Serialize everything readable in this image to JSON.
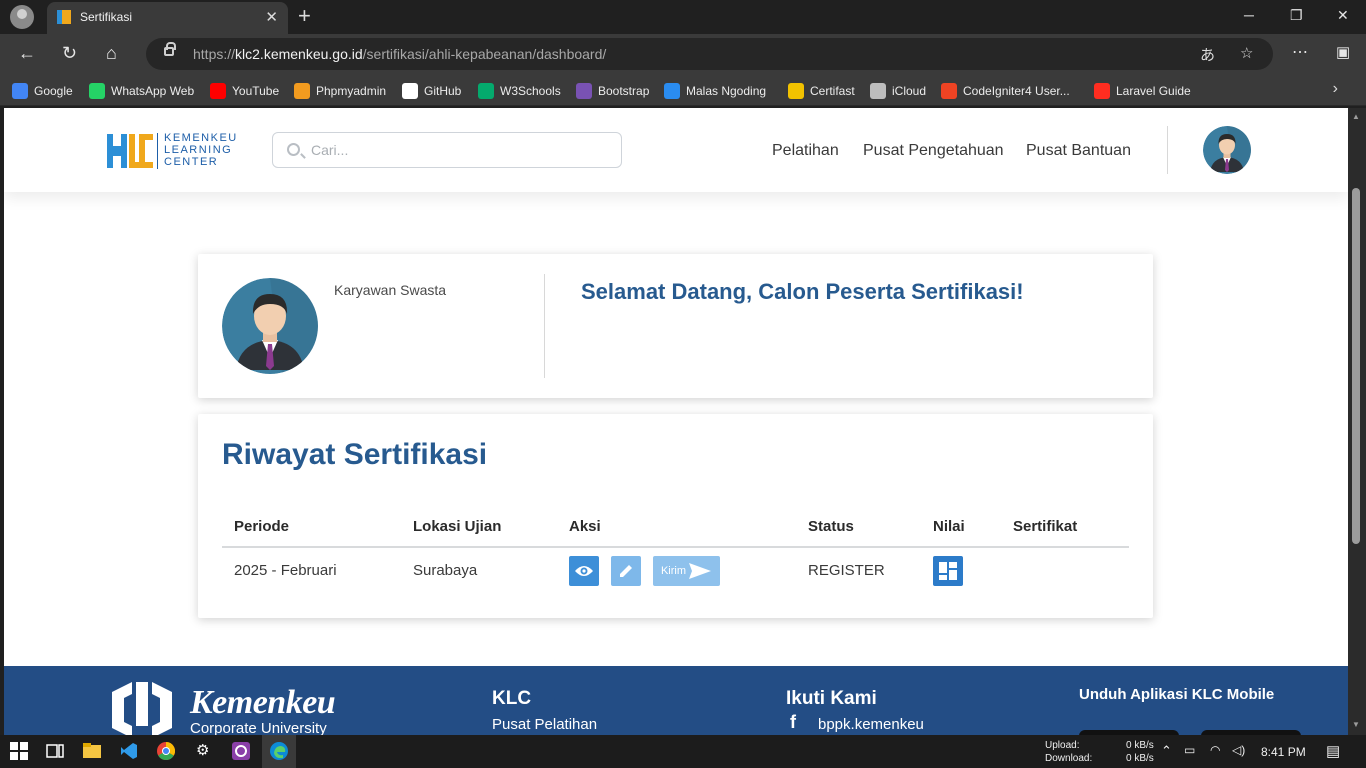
{
  "browser": {
    "tab_title": "Sertifikasi",
    "url_scheme": "https://",
    "url_host": "klc2.kemenkeu.go.id",
    "url_path": "/sertifikasi/ahli-kepabeanan/dashboard/",
    "bookmarks": [
      {
        "label": "Google",
        "icon": "google-icon",
        "color": "#4285f4"
      },
      {
        "label": "WhatsApp Web",
        "icon": "whatsapp-icon",
        "color": "#25d366"
      },
      {
        "label": "YouTube",
        "icon": "youtube-icon",
        "color": "#ff0000"
      },
      {
        "label": "Phpmyadmin",
        "icon": "phpmyadmin-icon",
        "color": "#f29b1f"
      },
      {
        "label": "GitHub",
        "icon": "github-icon",
        "color": "#ffffff"
      },
      {
        "label": "W3Schools",
        "icon": "w3schools-icon",
        "color": "#04aa6d"
      },
      {
        "label": "Bootstrap",
        "icon": "bootstrap-icon",
        "color": "#7952b3"
      },
      {
        "label": "Malas Ngoding",
        "icon": "malasngoding-icon",
        "color": "#2a8cf0"
      },
      {
        "label": "Certifast",
        "icon": "certifast-icon",
        "color": "#f2c200"
      },
      {
        "label": "iCloud",
        "icon": "apple-icon",
        "color": "#bdbdbd"
      },
      {
        "label": "CodeIgniter4 User...",
        "icon": "codeigniter-icon",
        "color": "#ee4323"
      },
      {
        "label": "Laravel Guide",
        "icon": "laravel-icon",
        "color": "#ff2d20"
      }
    ]
  },
  "site": {
    "logo_lines": [
      "KEMENKEU",
      "LEARNING",
      "CENTER"
    ],
    "search_placeholder": "Cari...",
    "nav": [
      "Pelatihan",
      "Pusat Pengetahuan",
      "Pusat Bantuan"
    ],
    "accent_color": "#275a8f"
  },
  "profile": {
    "occupation": "Karyawan Swasta",
    "welcome": "Selamat Datang, Calon Peserta Sertifikasi!"
  },
  "history": {
    "title": "Riwayat Sertifikasi",
    "columns": [
      "Periode",
      "Lokasi Ujian",
      "Aksi",
      "Status",
      "Nilai",
      "Sertifikat"
    ],
    "rows": [
      {
        "periode": "2025 - Februari",
        "lokasi": "Surabaya",
        "send_label": "Kirim",
        "status": "REGISTER",
        "sertifikat": ""
      }
    ]
  },
  "footer": {
    "brand": "Kemenkeu",
    "brand_sub": "Corporate University",
    "klc_title": "KLC",
    "klc_link": "Pusat Pelatihan",
    "follow_title": "Ikuti Kami",
    "follow_link": "bppk.kemenkeu",
    "app_title": "Unduh Aplikasi KLC Mobile"
  },
  "taskbar": {
    "upload_label": "Upload:",
    "upload_value": "0 kB/s",
    "download_label": "Download:",
    "download_value": "0 kB/s",
    "time": "8:41 PM"
  }
}
